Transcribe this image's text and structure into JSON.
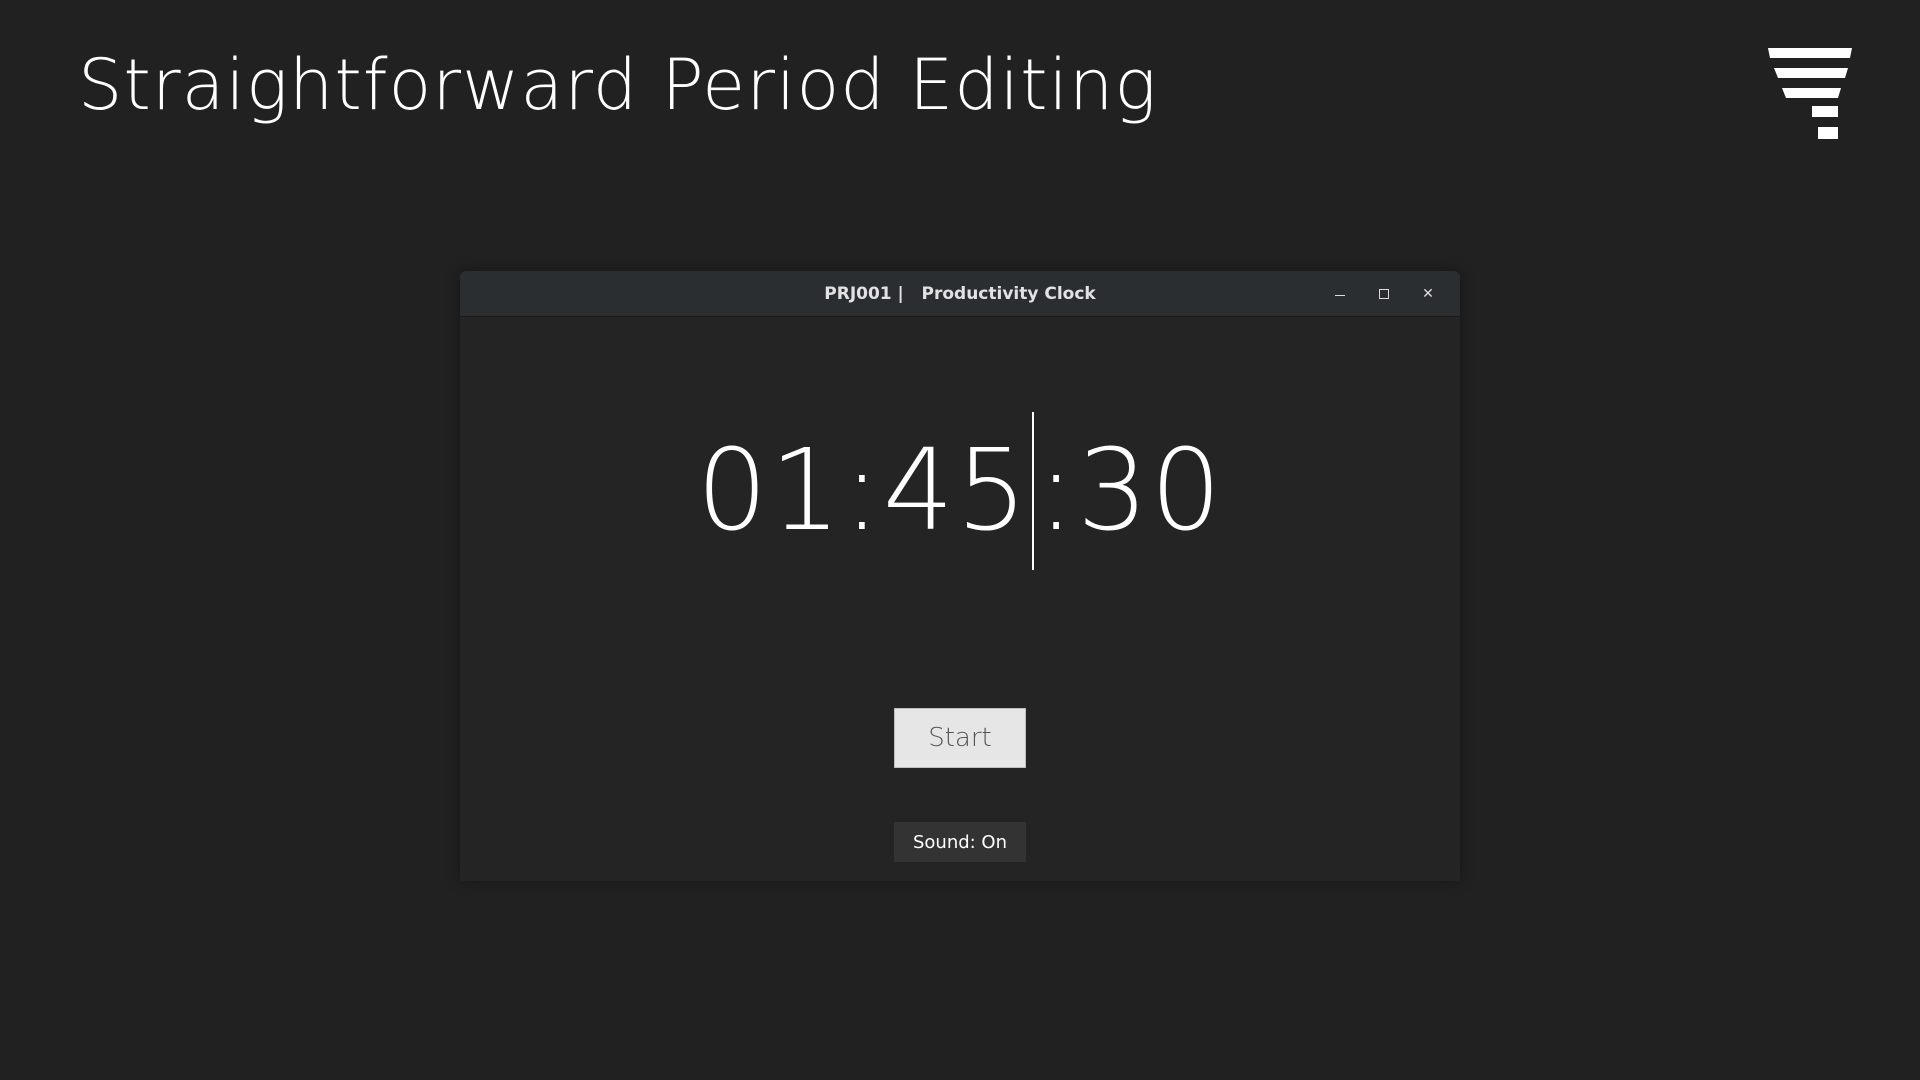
{
  "slide": {
    "title": "Straightforward Period Editing"
  },
  "window": {
    "title": "PRJ001 |   Productivity Clock",
    "controls": {
      "minimize_icon": "minimize-icon",
      "maximize_icon": "maximize-icon",
      "close_icon": "close-icon",
      "close_glyph": "✕"
    }
  },
  "clock": {
    "before_cursor": "01:45",
    "after_cursor": ":30"
  },
  "buttons": {
    "start_label": "Start",
    "sound_label": "Sound: On"
  },
  "colors": {
    "background": "#212121",
    "window_body": "#242424",
    "titlebar": "#2b2e31",
    "clock_text": "#ffffff",
    "start_button_bg": "#e6e6e6",
    "sound_button_bg": "#333333"
  }
}
